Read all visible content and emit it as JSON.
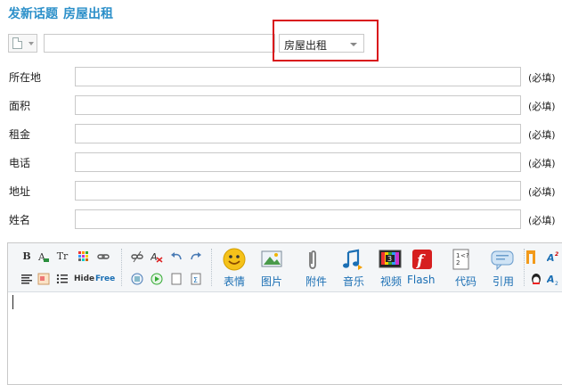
{
  "header": {
    "title": "发新话题",
    "subtitle": "房屋出租"
  },
  "top": {
    "subject_value": "",
    "type_selected": "房屋出租"
  },
  "fields": [
    {
      "label": "所在地",
      "value": "",
      "required": "(必填)"
    },
    {
      "label": "面积",
      "value": "",
      "required": "(必填)"
    },
    {
      "label": "租金",
      "value": "",
      "required": "(必填)"
    },
    {
      "label": "电话",
      "value": "",
      "required": "(必填)"
    },
    {
      "label": "地址",
      "value": "",
      "required": "(必填)"
    },
    {
      "label": "姓名",
      "value": "",
      "required": "(必填)"
    }
  ],
  "toolbar": {
    "small_row1": [
      "B",
      "",
      "Tr",
      "",
      ""
    ],
    "small_row2": [
      "",
      "",
      "",
      "Hide",
      "Free"
    ],
    "buttons": [
      "表情",
      "图片",
      "附件",
      "音乐",
      "视频",
      "Flash",
      "代码",
      "引用"
    ]
  }
}
